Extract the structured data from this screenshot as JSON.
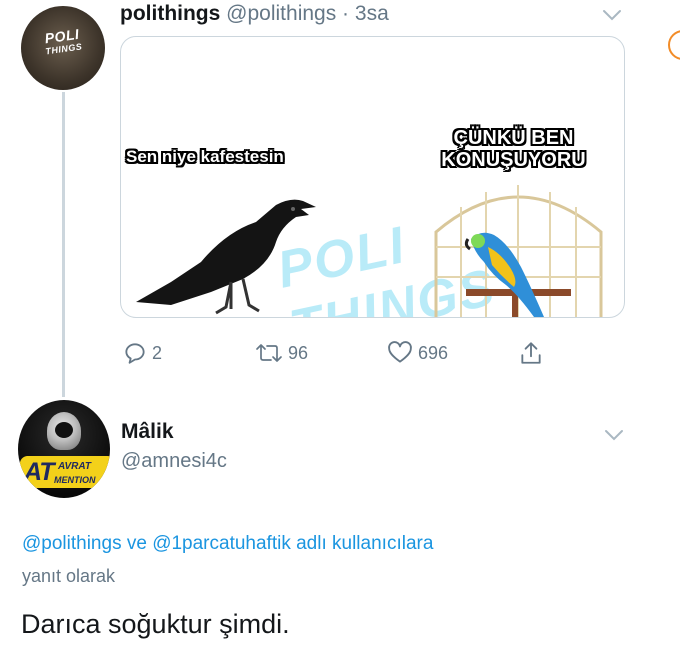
{
  "tweet": {
    "display_name": "polithings",
    "handle": "@polithings",
    "separator": " · ",
    "time": "3sa",
    "avatar": {
      "text_top": "POLI",
      "text_bottom": "THINGS"
    },
    "media": {
      "caption_left": "Sen niye kafestesin",
      "caption_right_line1": "ÇÜNKÜ BEN",
      "caption_right_line2": "KONUŞUYORU",
      "watermark": "POLI THINGS"
    },
    "actions": {
      "reply_count": "2",
      "retweet_count": "96",
      "like_count": "696"
    }
  },
  "reply": {
    "display_name": "Mâlik",
    "handle": "@amnesi4c",
    "avatar": {
      "badge_big": "AT",
      "badge_small1": "AVRAT",
      "badge_small2": "MENTION"
    },
    "reply_to_line": "@polithings ve @1parcatuhaftik adlı kullanıcılara",
    "reply_to_suffix": "yanıt olarak",
    "body": "Darıca soğuktur şimdi."
  },
  "colors": {
    "link": "#1b95e0",
    "secondary_text": "#657786",
    "primary_text": "#14171a",
    "border": "#ccd6dd",
    "badge_yellow": "#f3d11a"
  }
}
